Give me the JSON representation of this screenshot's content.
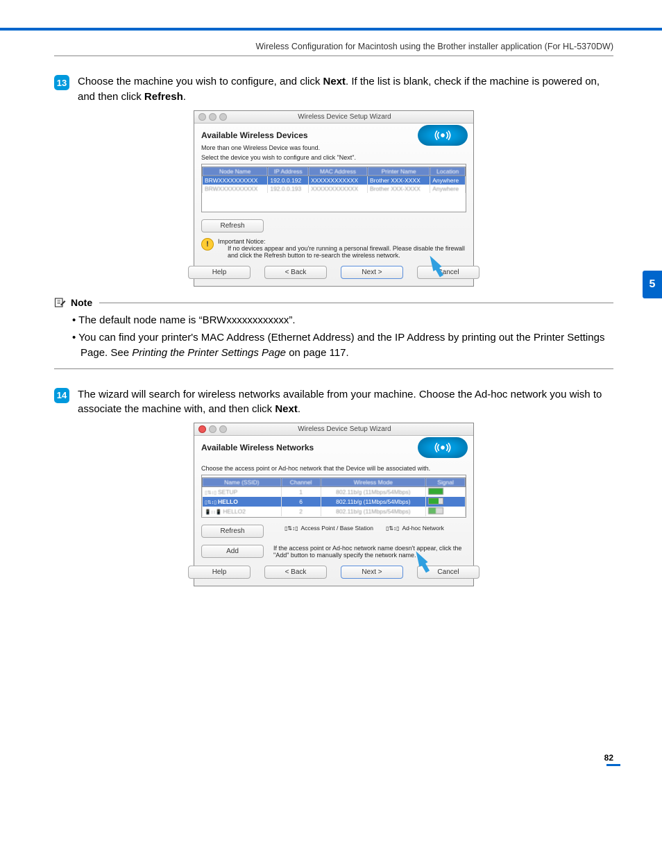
{
  "header": "Wireless Configuration for Macintosh using the Brother installer application (For HL-5370DW)",
  "side_tab": "5",
  "page_number": "82",
  "step13": {
    "num": "13",
    "text_a": "Choose the machine you wish to configure, and click ",
    "bold_a": "Next",
    "text_b": ". If the list is blank, check if the machine is powered on, and then click ",
    "bold_b": "Refresh",
    "text_c": "."
  },
  "wiz1": {
    "title": "Wireless Device Setup Wizard",
    "heading": "Available Wireless Devices",
    "sub1": "More than one Wireless Device was found.",
    "sub2": "Select the device you wish to configure and click \"Next\".",
    "cols": [
      "Node Name",
      "IP Address",
      "MAC Address",
      "Printer Name",
      "Location"
    ],
    "row_sel": [
      "BRWXXXXXXXXXX",
      "192.0.0.192",
      "XXXXXXXXXXXX",
      "Brother XXX-XXXX",
      "Anywhere"
    ],
    "row_blur": [
      "BRWXXXXXXXXXX",
      "192.0.0.193",
      "XXXXXXXXXXXX",
      "Brother XXX-XXXX",
      "Anywhere"
    ],
    "refresh": "Refresh",
    "notice_head": "Important Notice:",
    "notice_body": "If no devices appear and you're running a personal firewall. Please disable the firewall and click the Refresh button to re-search the wireless network.",
    "help": "Help",
    "back": "< Back",
    "next": "Next >",
    "cancel": "Cancel"
  },
  "note": {
    "label": "Note",
    "b1": "The default node name is “BRWxxxxxxxxxxxx”.",
    "b2a": "You can find your printer's MAC Address (Ethernet Address) and the IP Address by printing out the Printer Settings Page. See ",
    "b2i": "Printing the Printer Settings Page",
    "b2b": " on page 117."
  },
  "step14": {
    "num": "14",
    "text_a": "The wizard will search for wireless networks available from your machine. Choose the Ad-hoc network you wish to associate the machine with, and then click ",
    "bold_a": "Next",
    "text_b": "."
  },
  "wiz2": {
    "title": "Wireless Device Setup Wizard",
    "heading": "Available Wireless Networks",
    "sub": "Choose the access point or Ad-hoc network that the Device will be associated with.",
    "cols": [
      "Name (SSID)",
      "Channel",
      "Wireless Mode",
      "Signal"
    ],
    "row_blur1": [
      "SETUP",
      "1",
      "802.11b/g (11Mbps/54Mbps)",
      ""
    ],
    "row_sel": [
      "HELLO",
      "6",
      "802.11b/g (11Mbps/54Mbps)",
      ""
    ],
    "row_blur2": [
      "HELLO2",
      "2",
      "802.11b/g (11Mbps/54Mbps)",
      ""
    ],
    "refresh": "Refresh",
    "legend_ap": "Access Point / Base Station",
    "legend_adhoc": "Ad-hoc Network",
    "add": "Add",
    "add_text": "If the access point or Ad-hoc network name doesn't appear, click the \"Add\" button to manually specify the network name.",
    "help": "Help",
    "back": "< Back",
    "next": "Next >",
    "cancel": "Cancel"
  }
}
